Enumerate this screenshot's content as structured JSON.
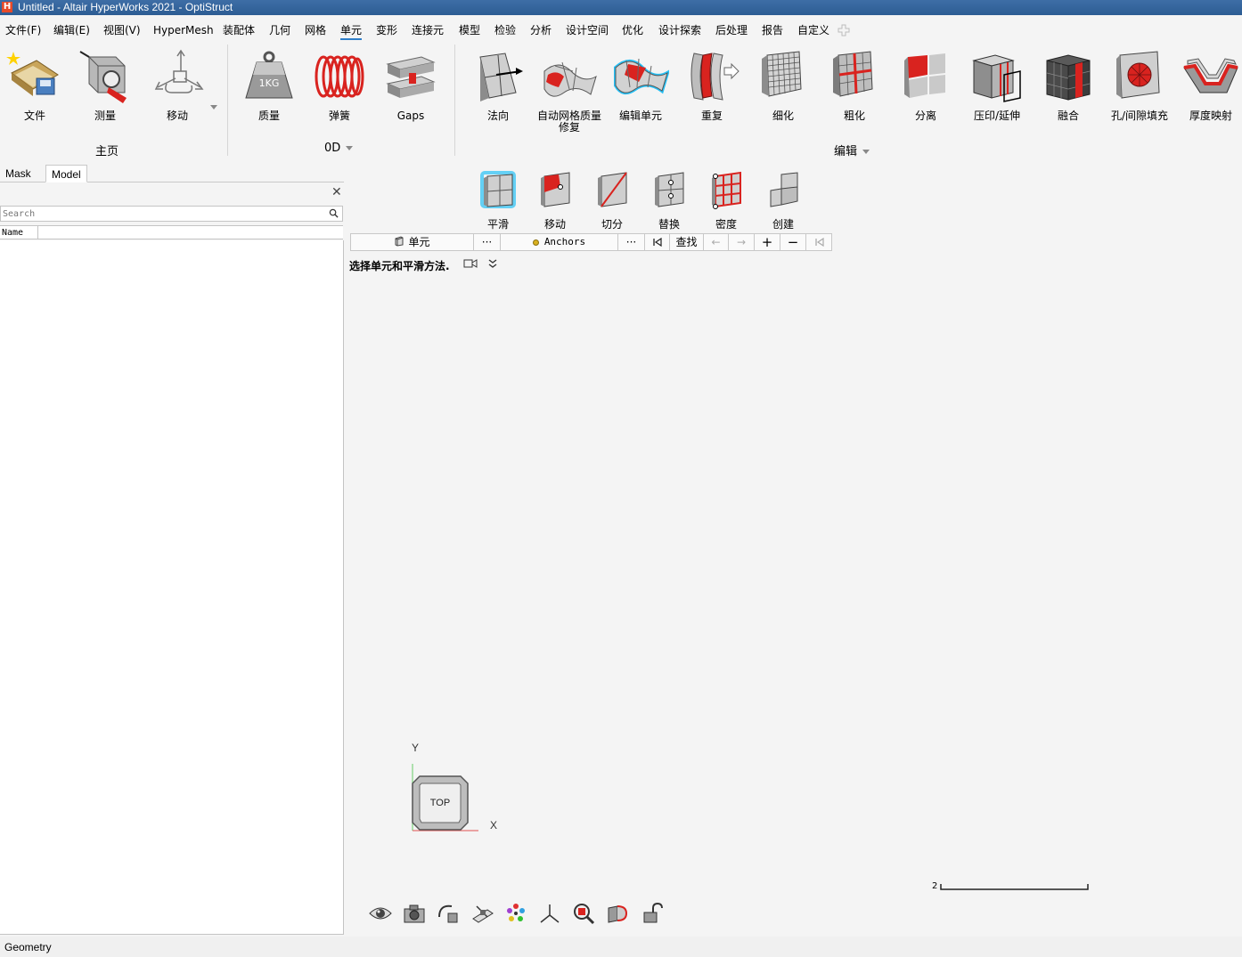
{
  "window": {
    "title": "Untitled - Altair HyperWorks 2021 - OptiStruct",
    "logo": "H"
  },
  "menu": [
    "文件(F)",
    "编辑(E)",
    "视图(V)",
    "HyperMesh",
    "装配体",
    "几何",
    "网格",
    "单元",
    "变形",
    "连接元",
    "模型",
    "检验",
    "分析",
    "设计空间",
    "优化",
    "设计探索",
    "后处理",
    "报告",
    "自定义"
  ],
  "menu_active": "单元",
  "ribbon": {
    "home": {
      "label": "主页",
      "tools": [
        "文件",
        "测量",
        "移动"
      ]
    },
    "zero_d": {
      "label": "0D",
      "tools": [
        "质量",
        "弹簧",
        "Gaps"
      ]
    },
    "edit": {
      "label": "编辑",
      "tools": [
        "法向",
        "自动网格质量修复",
        "编辑单元",
        "重复",
        "细化",
        "粗化",
        "分离",
        "压印/延伸",
        "融合",
        "孔/间隙填充",
        "厚度映射"
      ]
    },
    "mass_icon_text": "1KG"
  },
  "panel": {
    "tabs": [
      "Mask",
      "Model"
    ],
    "active_tab": "Model",
    "search_placeholder": "Search",
    "column_name": "Name"
  },
  "subtools": [
    "平滑",
    "移动",
    "切分",
    "替换",
    "密度",
    "创建"
  ],
  "selector": {
    "entity": "单元",
    "more": "···",
    "anchors": "Anchors",
    "more2": "···",
    "find": "查找"
  },
  "guide_text": "选择单元和平滑方法.",
  "viewcube": {
    "face": "TOP",
    "axis_y": "Y",
    "axis_x": "X"
  },
  "scale": {
    "value": "2"
  },
  "status": {
    "text": "Geometry"
  },
  "colors": {
    "accent": "#2f7fc9",
    "red": "#d9231f",
    "titlebar": "#3e6ea6"
  }
}
